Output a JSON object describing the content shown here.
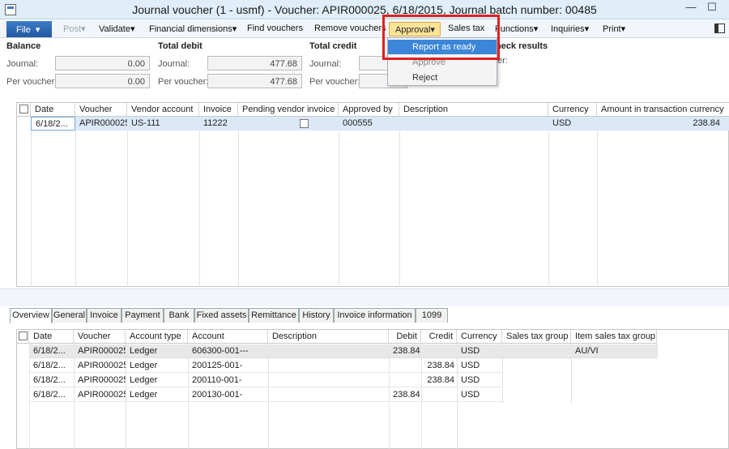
{
  "title": "Journal voucher (1 - usmf) - Voucher: APIR000025, 6/18/2015, Journal batch number: 00485",
  "window": {
    "min": "—",
    "max": "☐",
    "close": "✕"
  },
  "toolbar": {
    "file": "File",
    "post": "Post",
    "validate": "Validate",
    "financial_dimensions": "Financial dimensions",
    "find_vouchers": "Find vouchers",
    "remove_vouchers": "Remove vouchers",
    "approval": "Approval",
    "sales_tax": "Sales tax",
    "functions": "Functions",
    "inquiries": "Inquiries",
    "print": "Print",
    "caret": "▾"
  },
  "approval_menu": {
    "items": [
      "Report as ready",
      "Approve",
      "Reject"
    ]
  },
  "balance": {
    "balance_label": "Balance",
    "total_debit_label": "Total debit",
    "total_credit_label": "Total credit",
    "check_results_label": "Check results",
    "journal_label": "Journal:",
    "per_voucher_label": "Per voucher:",
    "balance_journal": "0.00",
    "balance_per_voucher": "0.00",
    "debit_journal": "477.68",
    "debit_per_voucher": "477.68",
    "credit_journal": "",
    "credit_per_voucher": "",
    "check_sub": "er:"
  },
  "lines": {
    "columns": [
      "Date",
      "Voucher",
      "Vendor account",
      "Invoice",
      "Pending vendor invoice",
      "Approved by",
      "Description",
      "Currency",
      "Amount in transaction currency"
    ],
    "rows": [
      {
        "date": "6/18/2...",
        "voucher": "APIR000025",
        "vendor": "US-111",
        "invoice": "11222",
        "pending": "",
        "approved": "000555",
        "description": "",
        "currency": "USD",
        "amount": "238.84"
      }
    ]
  },
  "tabs": [
    "Overview",
    "General",
    "Invoice",
    "Payment",
    "Bank",
    "Fixed assets",
    "Remittance",
    "History",
    "Invoice information",
    "1099"
  ],
  "ledger": {
    "columns": [
      "Date",
      "Voucher",
      "Account type",
      "Account",
      "Description",
      "Debit",
      "Credit",
      "Currency",
      "Sales tax group",
      "Item sales tax group"
    ],
    "rows": [
      {
        "date": "6/18/2...",
        "voucher": "APIR000025",
        "type": "Ledger",
        "account": "606300-001---",
        "description": "",
        "debit": "238.84",
        "credit": "",
        "currency": "USD",
        "stg": "",
        "istg": "AU/VI"
      },
      {
        "date": "6/18/2...",
        "voucher": "APIR000025",
        "type": "Ledger",
        "account": "200125-001-",
        "description": "",
        "debit": "",
        "credit": "238.84",
        "currency": "USD",
        "stg": "",
        "istg": ""
      },
      {
        "date": "6/18/2...",
        "voucher": "APIR000025",
        "type": "Ledger",
        "account": "200110-001-",
        "description": "",
        "debit": "",
        "credit": "238.84",
        "currency": "USD",
        "stg": "",
        "istg": ""
      },
      {
        "date": "6/18/2...",
        "voucher": "APIR000025",
        "type": "Ledger",
        "account": "200130-001-",
        "description": "",
        "debit": "238.84",
        "credit": "",
        "currency": "USD",
        "stg": "",
        "istg": ""
      }
    ]
  }
}
